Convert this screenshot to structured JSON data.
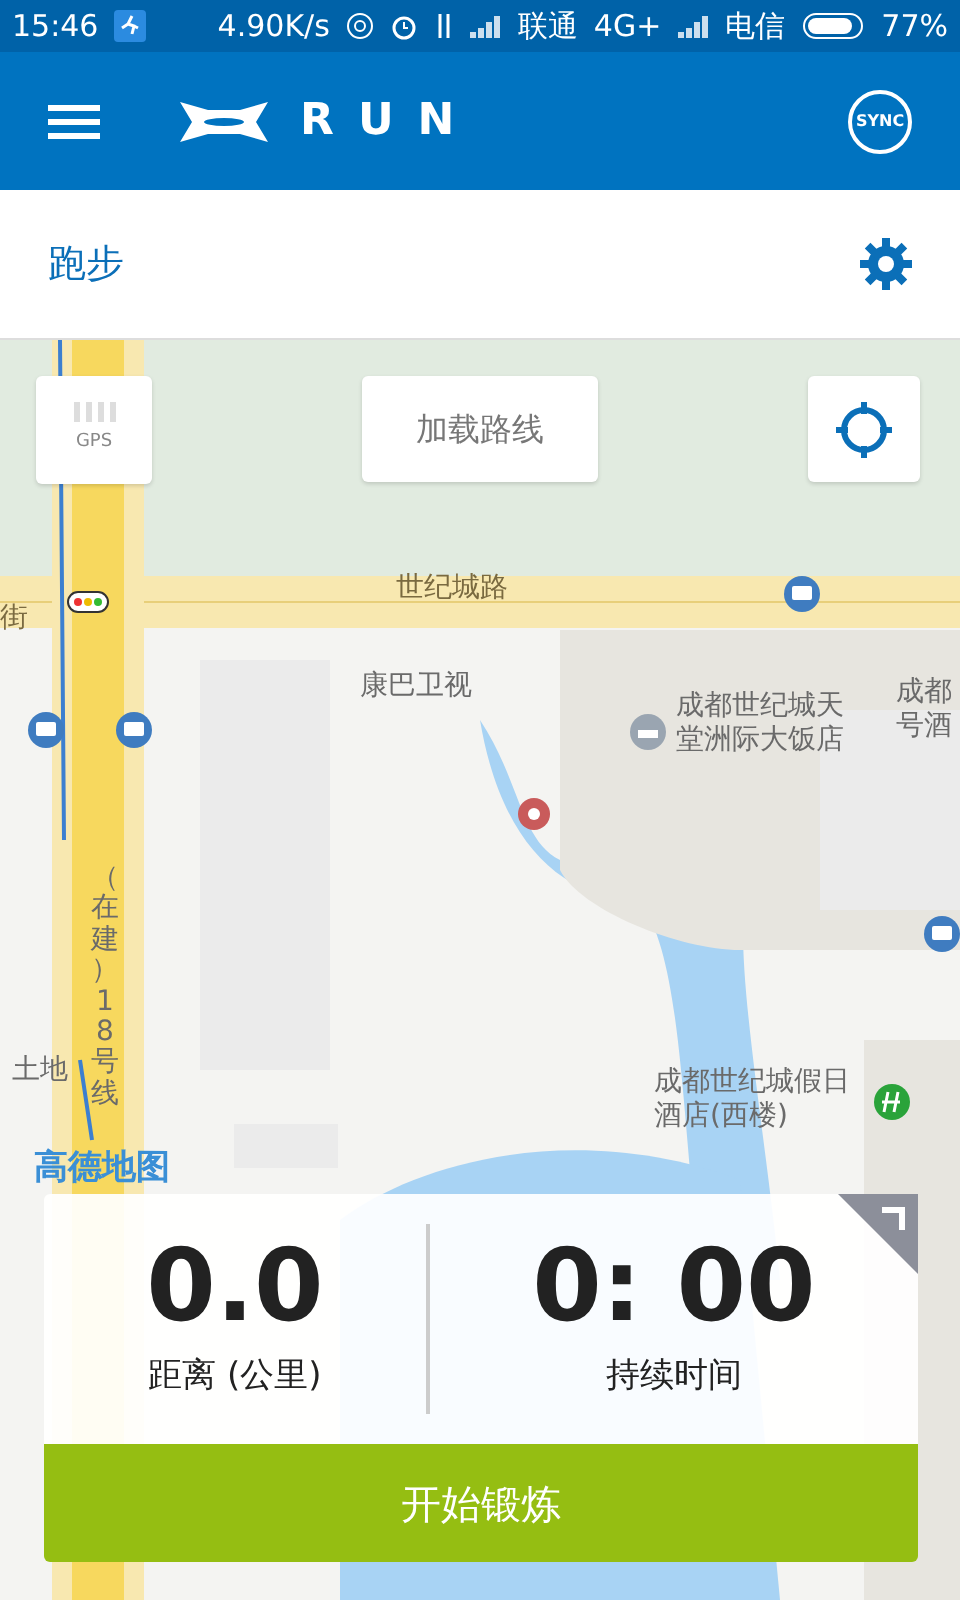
{
  "status_bar": {
    "time": "15:46",
    "speed": "4.90K/s",
    "carrier_1": "联通",
    "network_1": "4G+",
    "carrier_2": "电信",
    "battery": "77%"
  },
  "app_bar": {
    "logo_text": "RUN",
    "sync_label": "SYNC"
  },
  "activity": {
    "title": "跑步"
  },
  "map": {
    "gps_label": "GPS",
    "load_route": "加载路线",
    "attribution": "高德地图",
    "labels": [
      {
        "kind": "road",
        "text": "世纪城路"
      },
      {
        "kind": "poi",
        "text": "康巴卫视"
      },
      {
        "kind": "poi",
        "text": "成都世纪城天堂洲际大饭店"
      },
      {
        "kind": "poi",
        "text": "成都世纪城假日酒店(西楼)"
      },
      {
        "kind": "poi",
        "text": "成都号酒"
      },
      {
        "kind": "road",
        "text": "街"
      },
      {
        "kind": "poi",
        "text": "土地"
      },
      {
        "kind": "vertical",
        "text": "（在建）18号线"
      }
    ]
  },
  "stats": [
    {
      "value": "0.0",
      "label": "距离 (公里)"
    },
    {
      "value": "0: 00",
      "label": "持续时间"
    }
  ],
  "start_button": "开始锻炼"
}
